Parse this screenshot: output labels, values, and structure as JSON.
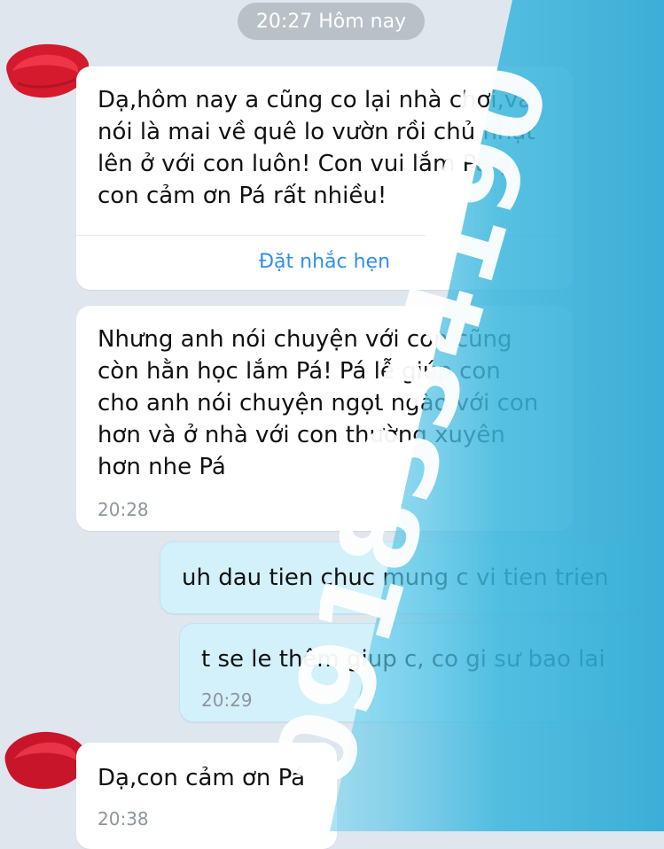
{
  "header": {
    "time_divider": "20:27 Hôm nay"
  },
  "messages": [
    {
      "text": "Dạ,hôm nay a cũng co lại nhà chơi,và\nnói là mai về quê lo vườn rồi chủ nhật\nlên ở với con luôn! Con vui lắm Pá ạ,\ncon cảm ơn Pá rất nhiều!",
      "action": "Đặt nhắc hẹn"
    },
    {
      "text": "Nhưng anh nói chuyện với con cũng\ncòn hằn học lắm Pá! Pá lễ giúp con\ncho anh nói chuyện ngọt ngào với con\nhơn và ở nhà với con thường xuyên\nhơn nhe Pá",
      "time": "20:28"
    },
    {
      "text": "uh dau tien chuc mung c vi tien trien"
    },
    {
      "text": "t se le thêm giup c, co gi sư bao lai",
      "time": "20:29"
    },
    {
      "text": "Dạ,con cảm ơn Pá",
      "time": "20:38"
    }
  ],
  "watermark": {
    "phone": "0918334190"
  },
  "colors": {
    "background": "#dfe6ee",
    "outgoing_bubble": "#d3f1fb",
    "link": "#2f8ff0",
    "watermark_band": "#44bde0"
  }
}
